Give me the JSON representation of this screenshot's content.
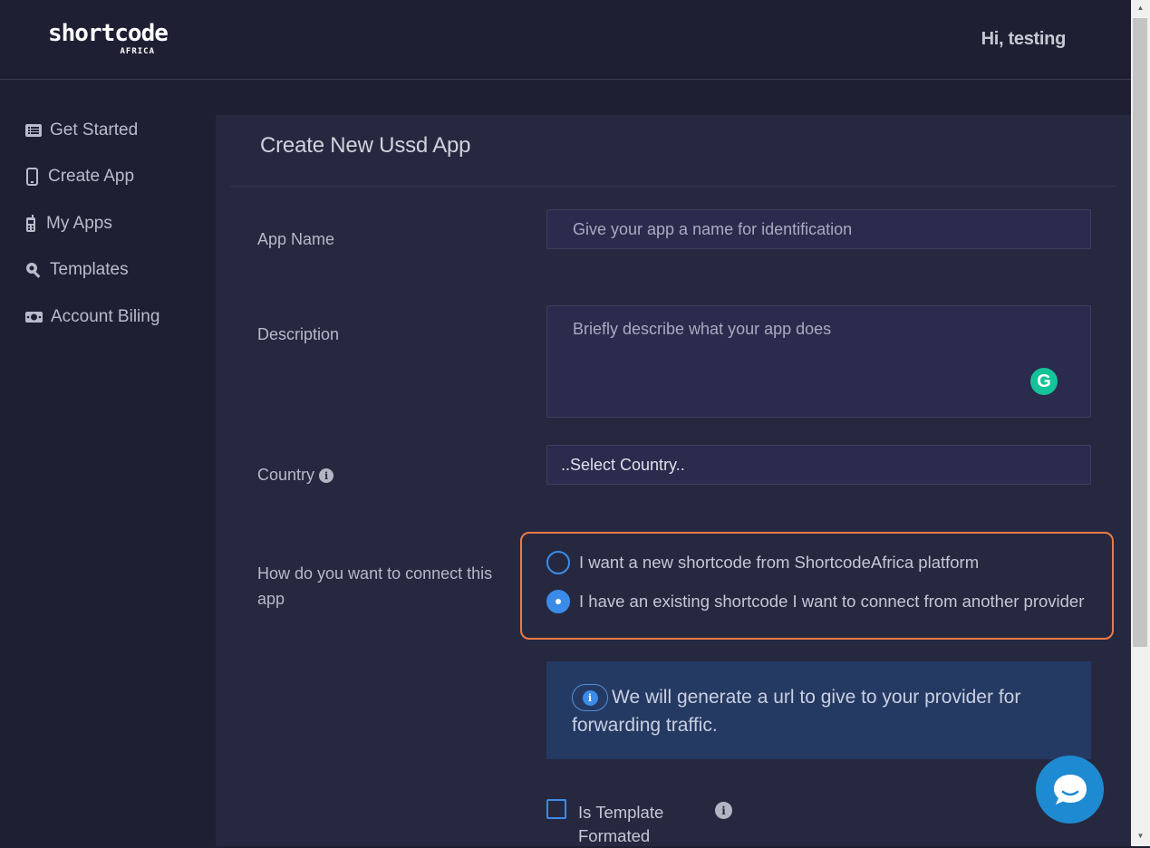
{
  "header": {
    "logo_main": "shortcode",
    "logo_sub": "AFRICA",
    "greeting": "Hi, testing"
  },
  "sidebar": {
    "items": [
      {
        "label": "Get Started",
        "icon": "list-icon"
      },
      {
        "label": "Create App",
        "icon": "mobile-icon"
      },
      {
        "label": "My Apps",
        "icon": "phone-icon"
      },
      {
        "label": "Templates",
        "icon": "search-icon"
      },
      {
        "label": "Account Biling",
        "icon": "money-icon"
      }
    ]
  },
  "form": {
    "title": "Create New Ussd App",
    "app_name_label": "App Name",
    "app_name_placeholder": "Give your app a name for identification",
    "description_label": "Description",
    "description_placeholder": "Briefly describe what your app does",
    "country_label": "Country",
    "country_value": "..Select Country..",
    "connect_label": "How do you want to connect this app",
    "connect_options": [
      {
        "label": "I want a new shortcode from ShortcodeAfrica platform",
        "checked": false
      },
      {
        "label": "I have an existing shortcode I want to connect from another provider",
        "checked": true
      }
    ],
    "alert_text": "We will generate a url to give to your provider for forwarding traffic.",
    "template_label": "Is Template Formated",
    "template_checked": false
  },
  "colors": {
    "background": "#1f1f33",
    "panel": "#262840",
    "accent": "#3b8ce8",
    "highlight_border": "#ee7a44",
    "alert_bg": "#253a63",
    "grammarly": "#15c39a",
    "chat": "#1e8ad1"
  }
}
